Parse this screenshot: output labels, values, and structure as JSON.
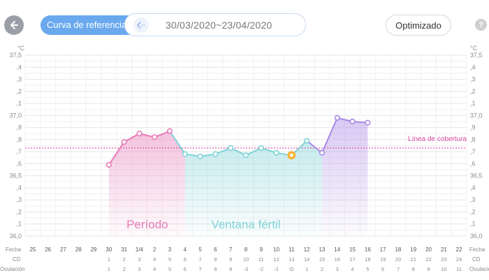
{
  "header": {
    "reference_label": "Curva de referencia",
    "date_range": "30/03/2020~23/04/2020",
    "optimize_label": "Optimizado",
    "help_glyph": "?"
  },
  "colors": {
    "period": "#e879b8",
    "fertile": "#7fd2d8",
    "luteal": "#a987e6",
    "cover_line": "#d94aa0",
    "ovulation_marker": "#f6b233",
    "accent": "#6aa9ee"
  },
  "chart_data": {
    "type": "line",
    "unit": "°C",
    "ylim": [
      36.0,
      37.5
    ],
    "y_ticks": [
      "37,5",
      ",4",
      ",3",
      ",2",
      ",1",
      "37,0",
      ",9",
      ",8",
      ",7",
      ",6",
      "36,5",
      ",4",
      ",3",
      ",2",
      ",1",
      "36,0"
    ],
    "cover_line": {
      "label": "Línea de cobertura",
      "value": 36.73
    },
    "row_labels": {
      "date": "Fecha",
      "cycle_day": "CD",
      "ovulation": "Ovulación"
    },
    "dates": [
      "25",
      "26",
      "27",
      "28",
      "29",
      "30",
      "31",
      "1/4",
      "2",
      "3",
      "4",
      "5",
      "6",
      "7",
      "8",
      "9",
      "10",
      "11",
      "12",
      "13",
      "14",
      "15",
      "16",
      "17",
      "18",
      "19",
      "20",
      "21",
      "22"
    ],
    "cycle_days": [
      "",
      "",
      "",
      "",
      "",
      "1",
      "2",
      "3",
      "4",
      "5",
      "6",
      "7",
      "8",
      "9",
      "10",
      "11",
      "12",
      "13",
      "14",
      "15",
      "16",
      "17",
      "18",
      "19",
      "20",
      "21",
      "22",
      "23",
      "24"
    ],
    "ovulation_days": [
      "",
      "",
      "",
      "",
      "",
      "1",
      "2",
      "3",
      "4",
      "5",
      "6",
      "7",
      "8",
      "9",
      "-3",
      "-2",
      "-1",
      "O",
      "1",
      "2",
      "3",
      "4",
      "5",
      "6",
      "7",
      "8",
      "9",
      "10",
      "11"
    ],
    "series": [
      {
        "values": [
          null,
          null,
          null,
          null,
          null,
          36.59,
          36.78,
          36.85,
          36.82,
          36.87,
          36.68,
          36.66,
          36.68,
          36.73,
          36.67,
          36.73,
          36.69,
          36.67,
          36.79,
          36.69,
          36.98,
          36.95,
          36.94,
          null,
          null,
          null,
          null,
          null,
          null
        ]
      }
    ],
    "ovulation_index": 17,
    "phases": [
      {
        "label": "Período",
        "start": 5,
        "end": 9,
        "color": "#e879b8"
      },
      {
        "label": "Ventana fértil",
        "start": 10,
        "end": 18,
        "color": "#7fd2d8"
      },
      {
        "label": "",
        "start": 19,
        "end": 22,
        "color": "#a987e6"
      }
    ],
    "grid": true
  }
}
